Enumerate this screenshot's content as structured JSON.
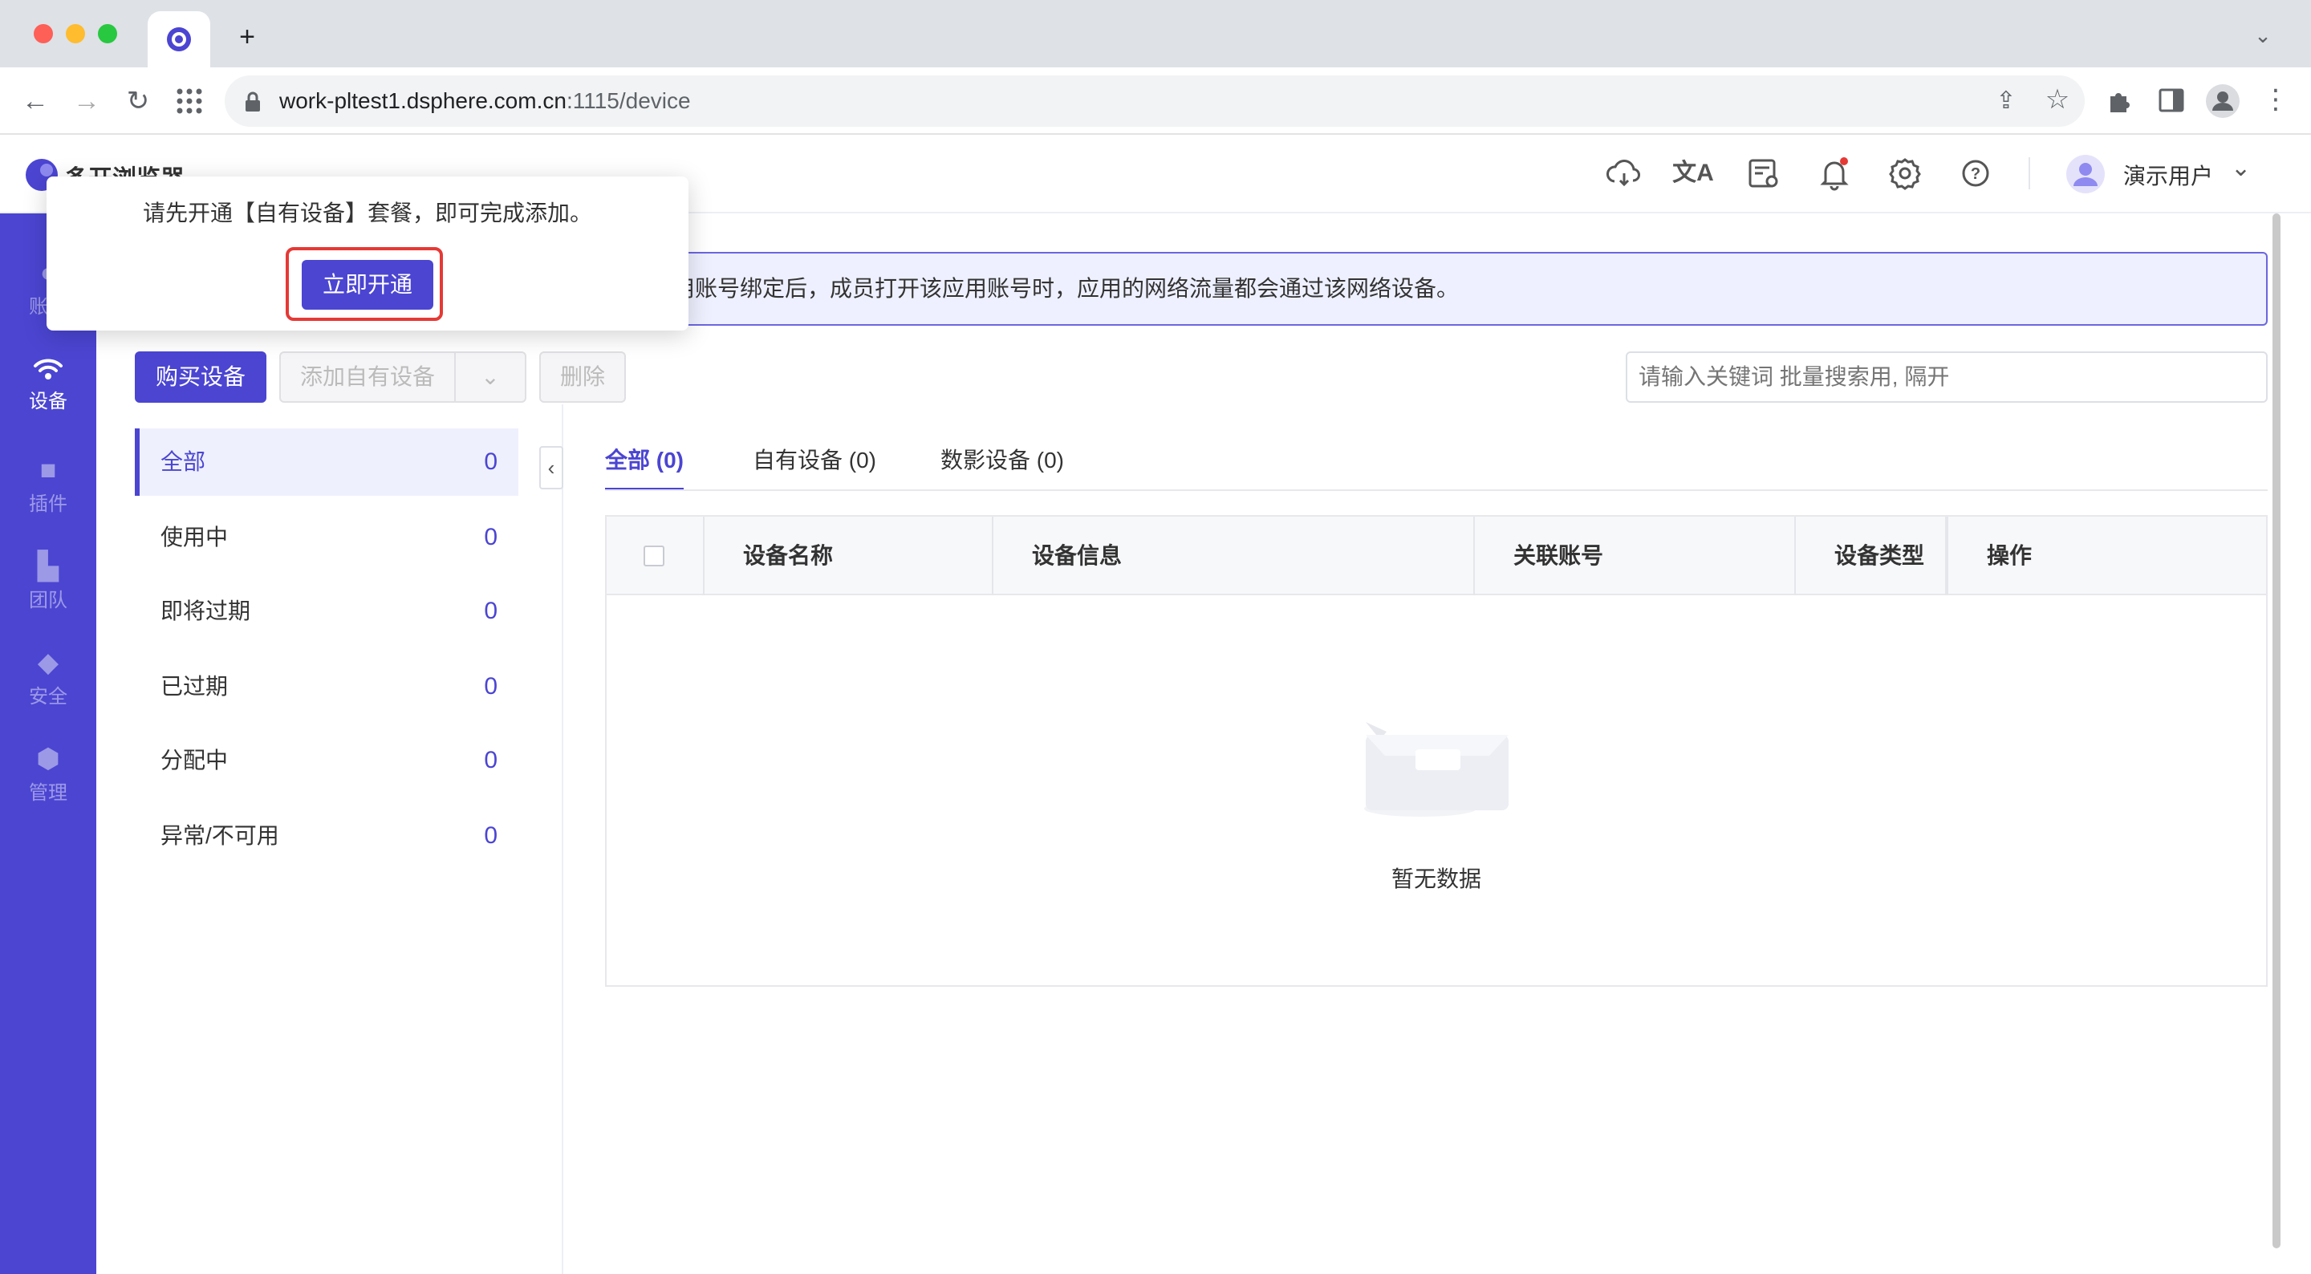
{
  "browser": {
    "url_host": "work-pltest1.dsphere.com.cn",
    "url_path": ":1115/device",
    "new_tab_label": "+"
  },
  "app": {
    "logo_text": "多开浏览器",
    "user_name": "演示用户"
  },
  "sidebar": {
    "items": [
      {
        "label": "账号",
        "icon": "user-icon"
      },
      {
        "label": "设备",
        "icon": "wifi-icon"
      },
      {
        "label": "插件",
        "icon": "plugin-icon"
      },
      {
        "label": "团队",
        "icon": "team-icon"
      },
      {
        "label": "安全",
        "icon": "shield-icon"
      },
      {
        "label": "管理",
        "icon": "hexagon-settings-icon"
      }
    ]
  },
  "banner": {
    "text": "用账号绑定后，成员打开该应用账号时，应用的网络流量都会通过该网络设备。"
  },
  "toolbar": {
    "buy_label": "购买设备",
    "add_label": "添加自有设备",
    "delete_label": "删除",
    "search_placeholder": "请输入关键词 批量搜索用, 隔开"
  },
  "status_list": [
    {
      "label": "全部",
      "count": "0"
    },
    {
      "label": "使用中",
      "count": "0"
    },
    {
      "label": "即将过期",
      "count": "0"
    },
    {
      "label": "已过期",
      "count": "0"
    },
    {
      "label": "分配中",
      "count": "0"
    },
    {
      "label": "异常/不可用",
      "count": "0"
    }
  ],
  "tabs": [
    {
      "label": "全部 (0)"
    },
    {
      "label": "自有设备 (0)"
    },
    {
      "label": "数影设备 (0)"
    }
  ],
  "table": {
    "columns": [
      "设备名称",
      "设备信息",
      "关联账号",
      "设备类型",
      "操作"
    ],
    "empty_text": "暂无数据"
  },
  "popover": {
    "text": "请先开通【自有设备】套餐，即可完成添加。",
    "button_label": "立即开通"
  },
  "colors": {
    "accent": "#4b45d2",
    "highlight_border": "#e53935"
  }
}
